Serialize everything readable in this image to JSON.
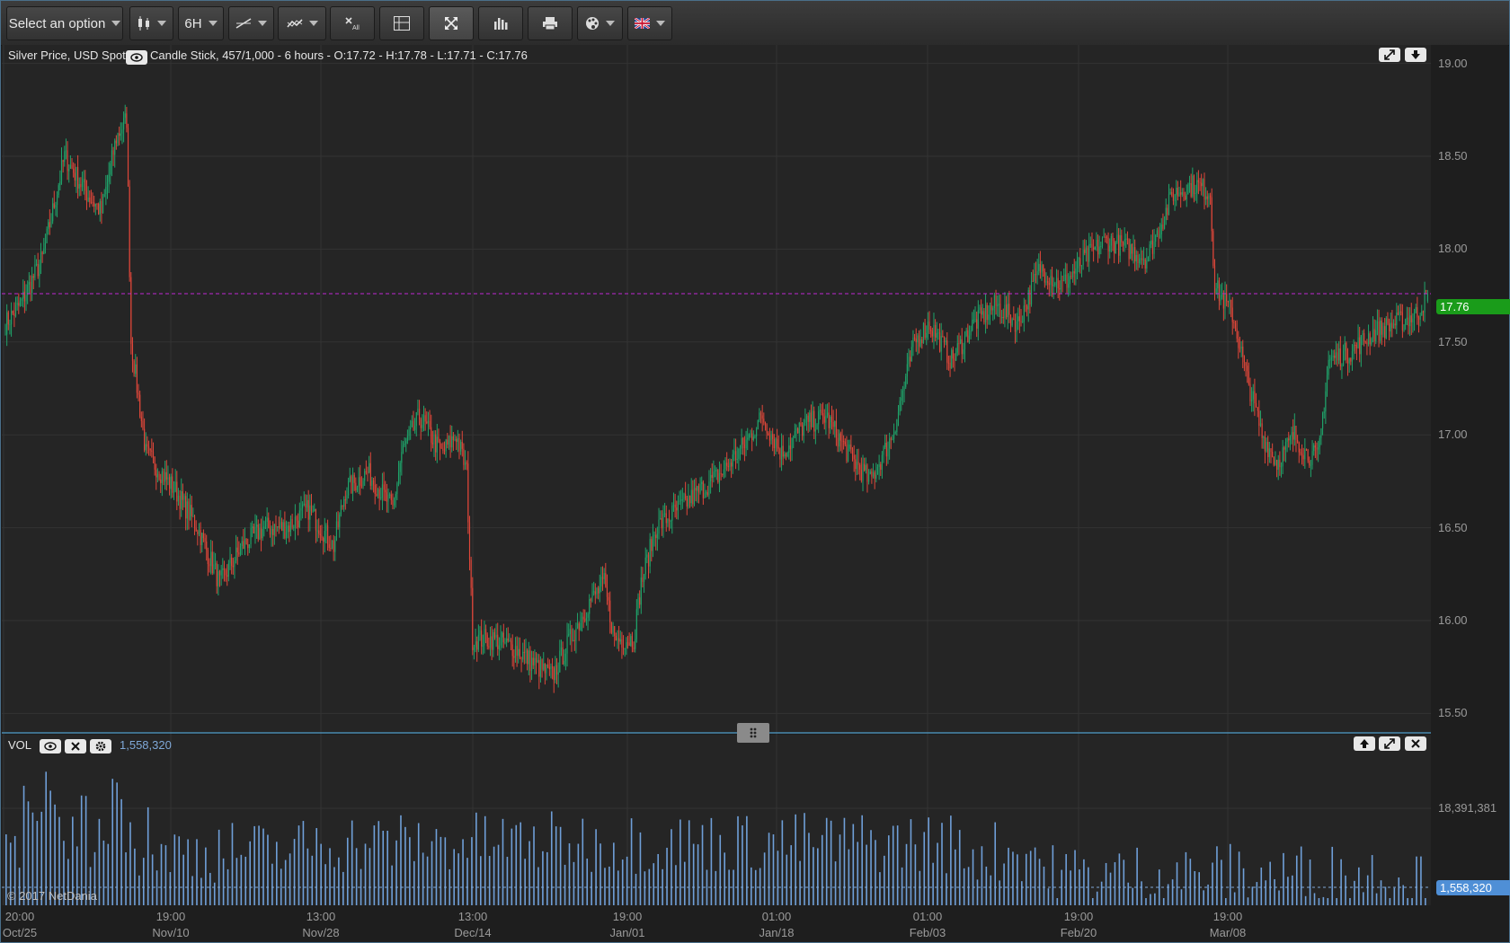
{
  "toolbar": {
    "select_label": "Select an option",
    "interval_label": "6H",
    "buttons": [
      "chart-type",
      "interval",
      "drawing-tools",
      "indicators",
      "clear-all",
      "crosshair",
      "fullscreen",
      "volume",
      "print",
      "theme",
      "language"
    ]
  },
  "price_pane": {
    "title": "Silver Price, USD Spot",
    "info": "Candle Stick, 457/1,000 - 6 hours - O:17.72 - H:17.78 - L:17.71 - C:17.76",
    "last_price": "17.76",
    "y_ticks": [
      "19.00",
      "18.50",
      "18.00",
      "17.50",
      "17.00",
      "16.50",
      "16.00",
      "15.50"
    ]
  },
  "volume_pane": {
    "title": "VOL",
    "value": "1,558,320",
    "max_label": "18,391,381",
    "last_label": "1,558,320"
  },
  "x_axis": {
    "times": [
      "20:00",
      "19:00",
      "13:00",
      "13:00",
      "19:00",
      "01:00",
      "01:00",
      "19:00",
      "19:00"
    ],
    "dates": [
      "Oct/25",
      "Nov/10",
      "Nov/28",
      "Dec/14",
      "Jan/01",
      "Jan/18",
      "Feb/03",
      "Feb/20",
      "Mar/08"
    ]
  },
  "copyright": "© 2017 NetDania",
  "colors": {
    "up": "#1fa36a",
    "down": "#e0473a",
    "volume": "#6f9fd8",
    "last_price_line": "#c026d3",
    "last_price_badge": "#1a9c1a",
    "volume_badge": "#4f8fd6"
  },
  "chart_data": {
    "type": "candlestick",
    "series_name": "Silver Price, USD Spot",
    "interval": "6 hours",
    "last": {
      "open": 17.72,
      "high": 17.78,
      "low": 17.71,
      "close": 17.76
    },
    "ylim": [
      15.4,
      19.1
    ],
    "y_ticks": [
      15.5,
      16.0,
      16.5,
      17.0,
      17.5,
      18.0,
      18.5,
      19.0
    ],
    "close_path": [
      [
        0,
        17.6
      ],
      [
        10,
        17.7
      ],
      [
        25,
        17.95
      ],
      [
        40,
        18.5
      ],
      [
        55,
        18.3
      ],
      [
        65,
        18.2
      ],
      [
        75,
        18.6
      ],
      [
        82,
        18.7
      ],
      [
        85,
        17.5
      ],
      [
        95,
        16.9
      ],
      [
        115,
        16.7
      ],
      [
        130,
        16.5
      ],
      [
        145,
        16.2
      ],
      [
        160,
        16.4
      ],
      [
        175,
        16.5
      ],
      [
        190,
        16.5
      ],
      [
        205,
        16.6
      ],
      [
        222,
        16.4
      ],
      [
        230,
        16.7
      ],
      [
        245,
        16.8
      ],
      [
        262,
        16.6
      ],
      [
        268,
        16.9
      ],
      [
        280,
        17.1
      ],
      [
        295,
        16.9
      ],
      [
        305,
        17.0
      ],
      [
        312,
        16.8
      ],
      [
        316,
        15.9
      ],
      [
        330,
        15.9
      ],
      [
        345,
        15.85
      ],
      [
        360,
        15.75
      ],
      [
        370,
        15.7
      ],
      [
        382,
        15.9
      ],
      [
        395,
        16.1
      ],
      [
        405,
        16.2
      ],
      [
        412,
        15.9
      ],
      [
        425,
        15.9
      ],
      [
        430,
        16.2
      ],
      [
        440,
        16.5
      ],
      [
        455,
        16.6
      ],
      [
        470,
        16.7
      ],
      [
        485,
        16.8
      ],
      [
        500,
        16.95
      ],
      [
        512,
        17.1
      ],
      [
        525,
        16.9
      ],
      [
        540,
        17.05
      ],
      [
        555,
        17.1
      ],
      [
        570,
        16.9
      ],
      [
        585,
        16.75
      ],
      [
        600,
        17.0
      ],
      [
        615,
        17.5
      ],
      [
        625,
        17.6
      ],
      [
        640,
        17.4
      ],
      [
        655,
        17.6
      ],
      [
        670,
        17.7
      ],
      [
        685,
        17.6
      ],
      [
        700,
        17.9
      ],
      [
        715,
        17.8
      ],
      [
        730,
        17.95
      ],
      [
        745,
        18.05
      ],
      [
        760,
        18.0
      ],
      [
        772,
        17.95
      ],
      [
        790,
        18.3
      ],
      [
        805,
        18.35
      ],
      [
        815,
        18.3
      ],
      [
        818,
        17.8
      ],
      [
        830,
        17.65
      ],
      [
        840,
        17.3
      ],
      [
        850,
        17.0
      ],
      [
        860,
        16.85
      ],
      [
        872,
        17.0
      ],
      [
        880,
        16.9
      ],
      [
        888,
        16.88
      ],
      [
        895,
        17.4
      ],
      [
        910,
        17.45
      ],
      [
        925,
        17.55
      ],
      [
        940,
        17.6
      ],
      [
        955,
        17.65
      ],
      [
        962,
        17.76
      ]
    ],
    "volume": {
      "max": 18391381,
      "last": 1558320
    }
  }
}
